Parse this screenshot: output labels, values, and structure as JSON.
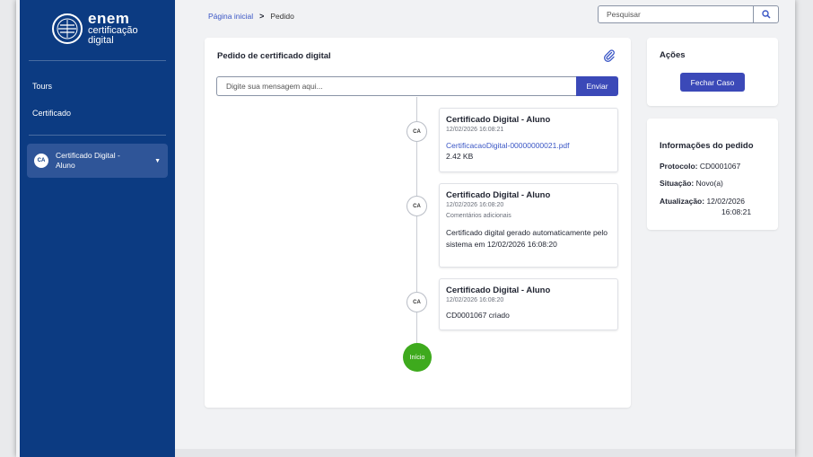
{
  "sidebar": {
    "logo": {
      "brand": "enem",
      "line1": "certificação",
      "line2": "digital"
    },
    "nav": [
      {
        "label": "Tours"
      },
      {
        "label": "Certificado"
      }
    ],
    "user": {
      "initials": "CA",
      "name": "Certificado Digital - Aluno"
    }
  },
  "header": {
    "breadcrumb": {
      "home": "Página inicial",
      "current": "Pedido"
    },
    "search": {
      "placeholder": "Pesquisar"
    }
  },
  "main": {
    "title": "Pedido de certificado digital",
    "message": {
      "placeholder": "Digite sua mensagem aqui...",
      "send_label": "Enviar"
    },
    "timeline": [
      {
        "initials": "CA",
        "title": "Certificado Digital - Aluno",
        "date": "12/02/2026 16:08:21",
        "file_name": "CertificacaoDigital-00000000021.pdf",
        "file_size": "2.42 KB"
      },
      {
        "initials": "CA",
        "title": "Certificado Digital - Aluno",
        "date": "12/02/2026 16:08:20",
        "subtitle": "Comentários adicionais",
        "text": "Certificado digital gerado automaticamente pelo sistema em 12/02/2026 16:08:20"
      },
      {
        "initials": "CA",
        "title": "Certificado Digital - Aluno",
        "date": "12/02/2026 16:08:20",
        "text": "CD0001067 criado"
      }
    ],
    "start_label": "Início"
  },
  "actions": {
    "title": "Ações",
    "close_label": "Fechar Caso"
  },
  "info": {
    "title": "Informações do pedido",
    "protocol_label": "Protocolo:",
    "protocol_value": "CD0001067",
    "status_label": "Situação:",
    "status_value": "Novo(a)",
    "updated_label": "Atualização:",
    "updated_date": "12/02/2026",
    "updated_time": "16:08:21"
  },
  "colors": {
    "sidebar": "#0c3b82",
    "primary": "#3b49b8",
    "link": "#3a56c5",
    "start": "#3eaa1d"
  }
}
